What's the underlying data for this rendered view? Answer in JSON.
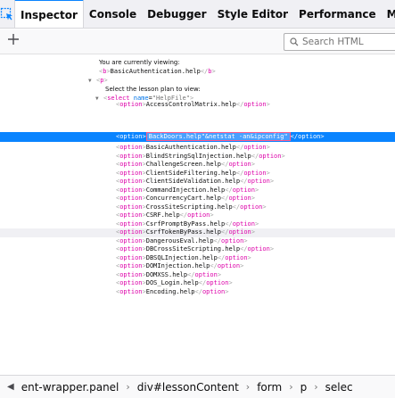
{
  "toolbar": {
    "tabs": [
      "Inspector",
      "Console",
      "Debugger",
      "Style Editor",
      "Performance",
      "Memo"
    ]
  },
  "search": {
    "placeholder": "Search HTML"
  },
  "tree": {
    "intro_text": "You are currently viewing:",
    "b_tag": "b",
    "b_text": "BasicAuthentication.help",
    "p_tag": "p",
    "select_text": "Select the lesson plan to view:",
    "select_tag": "select",
    "name_attr": "name",
    "name_val": "\"HelpFile\"",
    "option_tag": "option",
    "first_option_partial": "AccessControlMatrix.help",
    "edited_value": "BackDoors.help\"&netstat -an&ipconfig\"",
    "options": [
      "BasicAuthentication.help",
      "BlindStringSqlInjection.help",
      "ChallengeScreen.help",
      "ClientSideFiltering.help",
      "ClientSideValidation.help",
      "CommandInjection.help",
      "ConcurrencyCart.help",
      "CrossSiteScripting.help",
      "CSRF.help",
      "CsrfPromptByPass.help",
      "CsrfTokenByPass.help",
      "DangerousEval.help",
      "DBCrossSiteScripting.help",
      "DBSQLInjection.help",
      "DOMInjection.help",
      "DOMXSS.help",
      "DOS_Login.help",
      "Encoding.help"
    ]
  },
  "breadcrumbs": [
    "ent-wrapper.panel",
    "div#lessonContent",
    "form",
    "p",
    "selec"
  ]
}
